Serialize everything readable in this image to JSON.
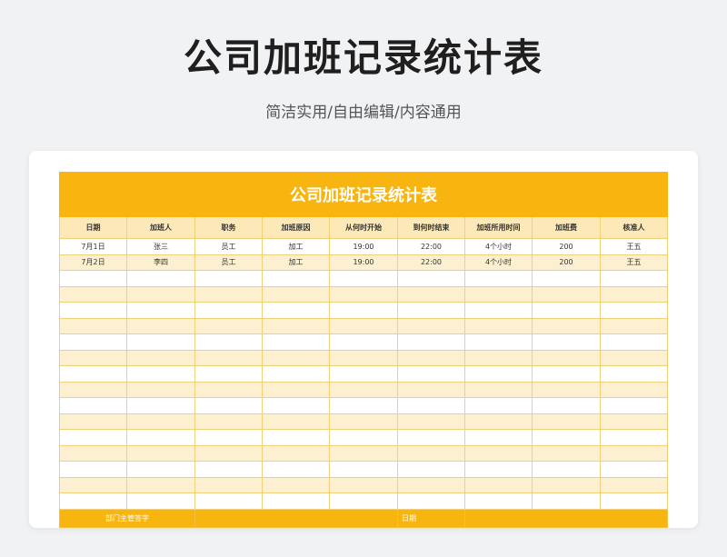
{
  "page": {
    "title": "公司加班记录统计表",
    "subtitle": "简洁实用/自由编辑/内容通用"
  },
  "sheet": {
    "title": "公司加班记录统计表",
    "headers": [
      "日期",
      "加班人",
      "职务",
      "加班原因",
      "从何时开始",
      "到何时结束",
      "加班所用时间",
      "加班费",
      "核准人"
    ],
    "rows": [
      [
        "7月1日",
        "张三",
        "员工",
        "加工",
        "19:00",
        "22:00",
        "4个小时",
        "200",
        "王五"
      ],
      [
        "7月2日",
        "李四",
        "员工",
        "加工",
        "19:00",
        "22:00",
        "4个小时",
        "200",
        "王五"
      ]
    ],
    "footer": {
      "sign_label": "部门主管签字",
      "date_label": "日期"
    }
  },
  "colors": {
    "accent": "#f8b40f",
    "header_band": "#fde9b8",
    "stripe": "#fdf0d0",
    "grid": "#f1d07a"
  }
}
